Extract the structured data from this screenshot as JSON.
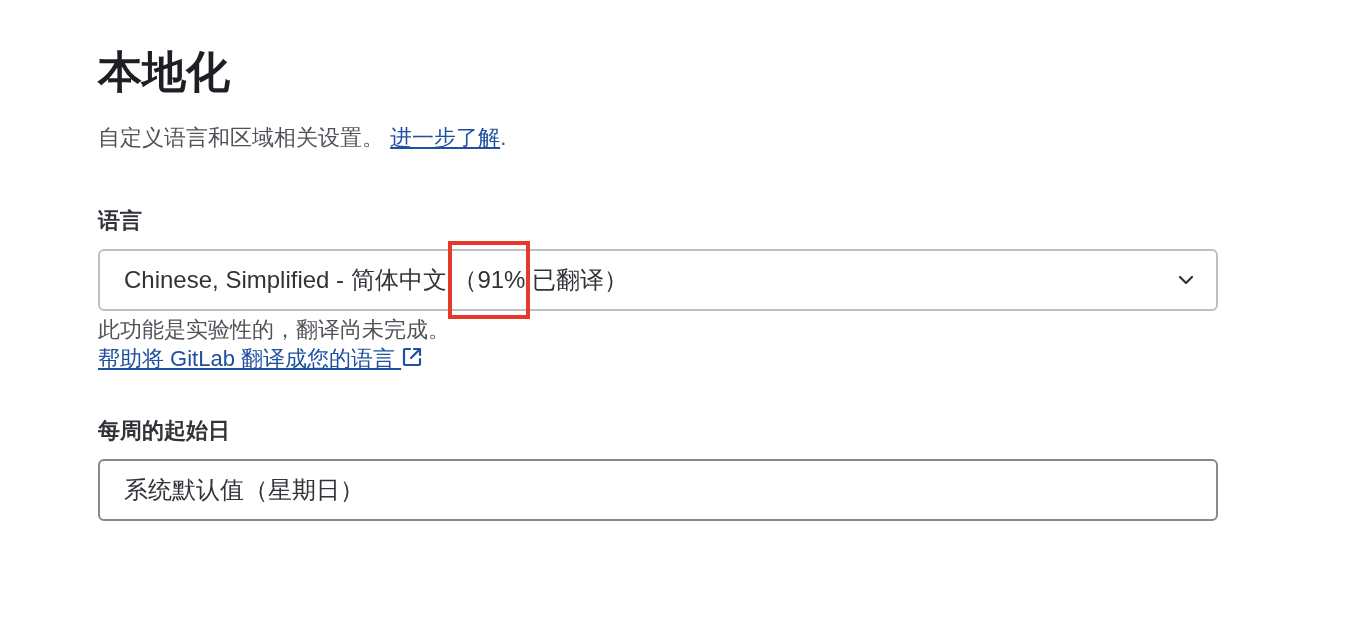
{
  "title": "本地化",
  "description": {
    "text": "自定义语言和区域相关设置。",
    "link": "进一步了解",
    "suffix": "."
  },
  "language": {
    "label": "语言",
    "value": "Chinese, Simplified - 简体中文 （91% 已翻译）",
    "help": "此功能是实验性的，翻译尚未完成。",
    "help_link": "帮助将 GitLab 翻译成您的语言"
  },
  "first_day_of_week": {
    "label": "每周的起始日",
    "value": "系统默认值（星期日）"
  }
}
